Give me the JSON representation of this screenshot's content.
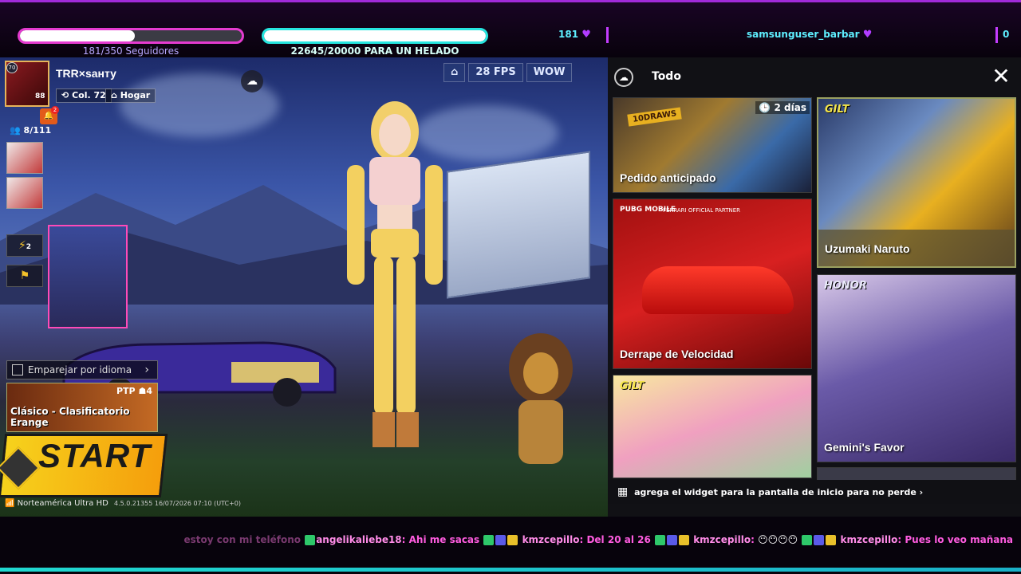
{
  "overlay": {
    "followers_label": "181/350 Seguidores",
    "followers_progress": 0.517,
    "goal_label": "22645/20000 PARA UN HELADO",
    "goal_progress": 1.0,
    "viewer_count": "181",
    "username": "samsunguser_barbar",
    "right_count": "0"
  },
  "player": {
    "level_badge": "70",
    "avatar_count": "88",
    "name": "TRR×saнту",
    "col_label": "Col. 72",
    "home_label": "Hogar",
    "notif_count": "2",
    "friends_count": "8/111",
    "energy_count": "2"
  },
  "hud": {
    "fps_label": "28 FPS",
    "wow_label": "WOW"
  },
  "matchmaking": {
    "language_match_label": "Emparejar por idioma",
    "ptp_label": "PTP",
    "ptp_count": "4",
    "mode_label": "Clásico - Clasificatorio  Erange",
    "start_label": "START"
  },
  "server": {
    "region": "Norteamérica Ultra HD",
    "version": "4.5.0.21355 16/07/2026 07:10 (UTC+0)"
  },
  "events_panel": {
    "title": "Todo",
    "events": [
      {
        "label": "Pedido anticipado",
        "timer": "2 días",
        "badge": "10DRAWS"
      },
      {
        "label": "Uzumaki Naruto",
        "brand": "GILT"
      },
      {
        "label": "Derrape de Velocidad",
        "brand": "PUBG MOBILE",
        "partner": "FERRARI OFFICIAL PARTNER"
      },
      {
        "label": "Gemini's Favor",
        "brand": "HONOR"
      },
      {
        "label": "",
        "brand": "GILT"
      },
      {
        "label": ""
      }
    ],
    "bottom_text": "agrega el widget para la pantalla de inicio para no perde"
  },
  "chat": {
    "messages": [
      {
        "user": "",
        "text": "estoy con mi teléfono"
      },
      {
        "user": "angelikaliebe18",
        "text": "Ahi me sacas"
      },
      {
        "user": "kmzcepillo",
        "text": "Del 20 al 26"
      },
      {
        "user": "kmzcepillo",
        "text": ""
      },
      {
        "user": "kmzcepillo",
        "text": "Pues lo veo mañana"
      }
    ]
  },
  "colors": {
    "accent_pink": "#e53bd0",
    "accent_cyan": "#26e6e0",
    "start_yellow": "#f6d21c"
  }
}
